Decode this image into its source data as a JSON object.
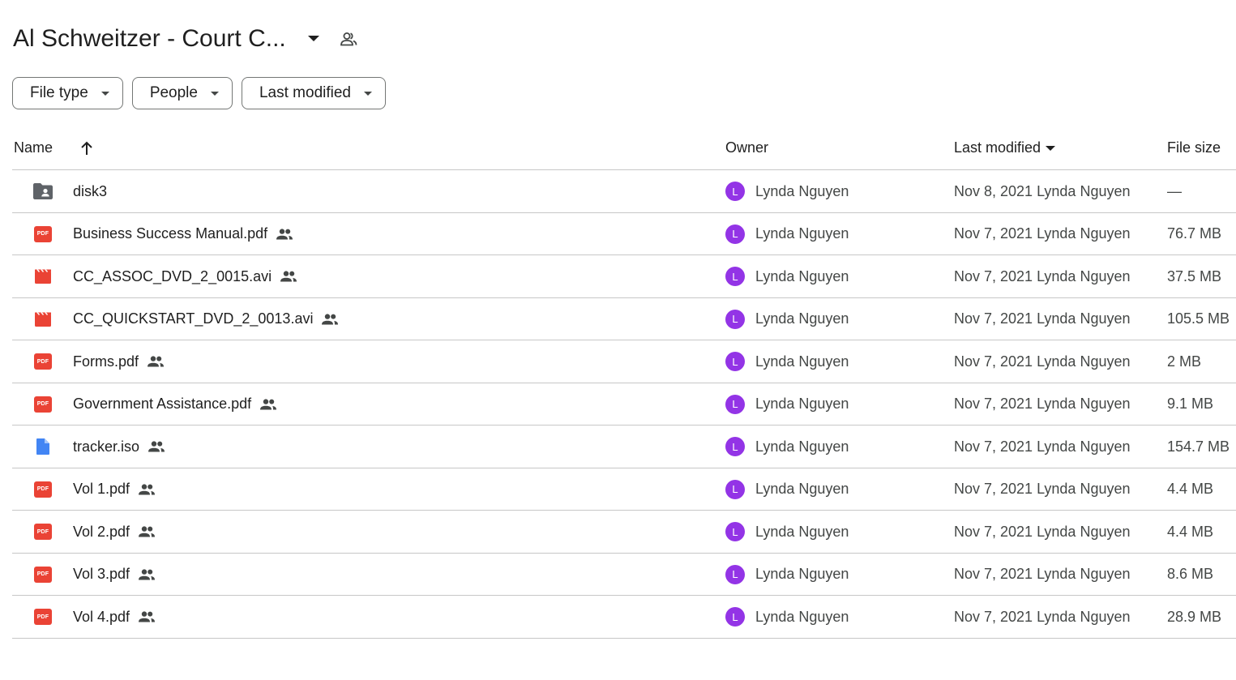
{
  "header": {
    "title": "Al Schweitzer - Court C...",
    "title_icon": "chevron-down-icon",
    "share_icon": "shared-folder-people-icon"
  },
  "filters": [
    {
      "label": "File type"
    },
    {
      "label": "People"
    },
    {
      "label": "Last modified"
    }
  ],
  "columns": {
    "name": "Name",
    "owner": "Owner",
    "last_modified": "Last modified",
    "file_size": "File size"
  },
  "colors": {
    "pdf": "#ea4335",
    "video": "#ea4335",
    "doc": "#4285f4",
    "folder": "#5f6368",
    "avatar": "#9334e6"
  },
  "files": [
    {
      "name": "disk3",
      "type": "folder",
      "shared": false,
      "owner": "Lynda Nguyen",
      "owner_initial": "L",
      "modified": "Nov 8, 2021 Lynda Nguyen",
      "size": "—"
    },
    {
      "name": "Business Success Manual.pdf",
      "type": "pdf",
      "shared": true,
      "owner": "Lynda Nguyen",
      "owner_initial": "L",
      "modified": "Nov 7, 2021 Lynda Nguyen",
      "size": "76.7 MB"
    },
    {
      "name": "CC_ASSOC_DVD_2_0015.avi",
      "type": "video",
      "shared": true,
      "owner": "Lynda Nguyen",
      "owner_initial": "L",
      "modified": "Nov 7, 2021 Lynda Nguyen",
      "size": "37.5 MB"
    },
    {
      "name": "CC_QUICKSTART_DVD_2_0013.avi",
      "type": "video",
      "shared": true,
      "owner": "Lynda Nguyen",
      "owner_initial": "L",
      "modified": "Nov 7, 2021 Lynda Nguyen",
      "size": "105.5 MB"
    },
    {
      "name": "Forms.pdf",
      "type": "pdf",
      "shared": true,
      "owner": "Lynda Nguyen",
      "owner_initial": "L",
      "modified": "Nov 7, 2021 Lynda Nguyen",
      "size": "2 MB"
    },
    {
      "name": "Government Assistance.pdf",
      "type": "pdf",
      "shared": true,
      "owner": "Lynda Nguyen",
      "owner_initial": "L",
      "modified": "Nov 7, 2021 Lynda Nguyen",
      "size": "9.1 MB"
    },
    {
      "name": "tracker.iso",
      "type": "doc",
      "shared": true,
      "owner": "Lynda Nguyen",
      "owner_initial": "L",
      "modified": "Nov 7, 2021 Lynda Nguyen",
      "size": "154.7 MB"
    },
    {
      "name": "Vol 1.pdf",
      "type": "pdf",
      "shared": true,
      "owner": "Lynda Nguyen",
      "owner_initial": "L",
      "modified": "Nov 7, 2021 Lynda Nguyen",
      "size": "4.4 MB"
    },
    {
      "name": "Vol 2.pdf",
      "type": "pdf",
      "shared": true,
      "owner": "Lynda Nguyen",
      "owner_initial": "L",
      "modified": "Nov 7, 2021 Lynda Nguyen",
      "size": "4.4 MB"
    },
    {
      "name": "Vol 3.pdf",
      "type": "pdf",
      "shared": true,
      "owner": "Lynda Nguyen",
      "owner_initial": "L",
      "modified": "Nov 7, 2021 Lynda Nguyen",
      "size": "8.6 MB"
    },
    {
      "name": "Vol 4.pdf",
      "type": "pdf",
      "shared": true,
      "owner": "Lynda Nguyen",
      "owner_initial": "L",
      "modified": "Nov 7, 2021 Lynda Nguyen",
      "size": "28.9 MB"
    }
  ]
}
